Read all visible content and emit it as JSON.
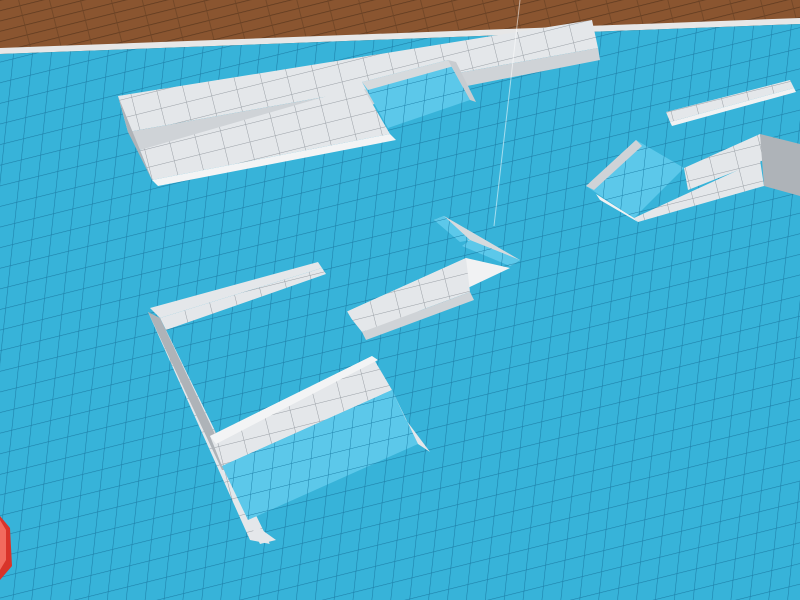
{
  "scene": {
    "description_visible_text": "",
    "colors": {
      "floor_tile": "#37b3d9",
      "floor_grout": "#1d7fa8",
      "wall_face": "#e4e7ea",
      "wall_shadow": "#aeb3b8",
      "wall_grid": "#9aa0a6",
      "ramp_surface": "#5cc8ea",
      "deck_wood": "#8a5530",
      "deck_wood_dark": "#5e3a20",
      "red_marker": "#d8342a"
    },
    "objects": [
      {
        "name": "pool-floor",
        "kind": "floor"
      },
      {
        "name": "wooden-deck",
        "kind": "deck"
      },
      {
        "name": "long-back-wall",
        "kind": "wall"
      },
      {
        "name": "back-wall-ramp",
        "kind": "ramp"
      },
      {
        "name": "right-ramp-structure",
        "kind": "ramp"
      },
      {
        "name": "far-right-low-wall",
        "kind": "wall"
      },
      {
        "name": "center-corner-wall",
        "kind": "wall"
      },
      {
        "name": "center-wall-segment",
        "kind": "wall"
      },
      {
        "name": "front-left-enclosure",
        "kind": "ramp"
      },
      {
        "name": "red-edge-marker",
        "kind": "marker"
      }
    ]
  }
}
